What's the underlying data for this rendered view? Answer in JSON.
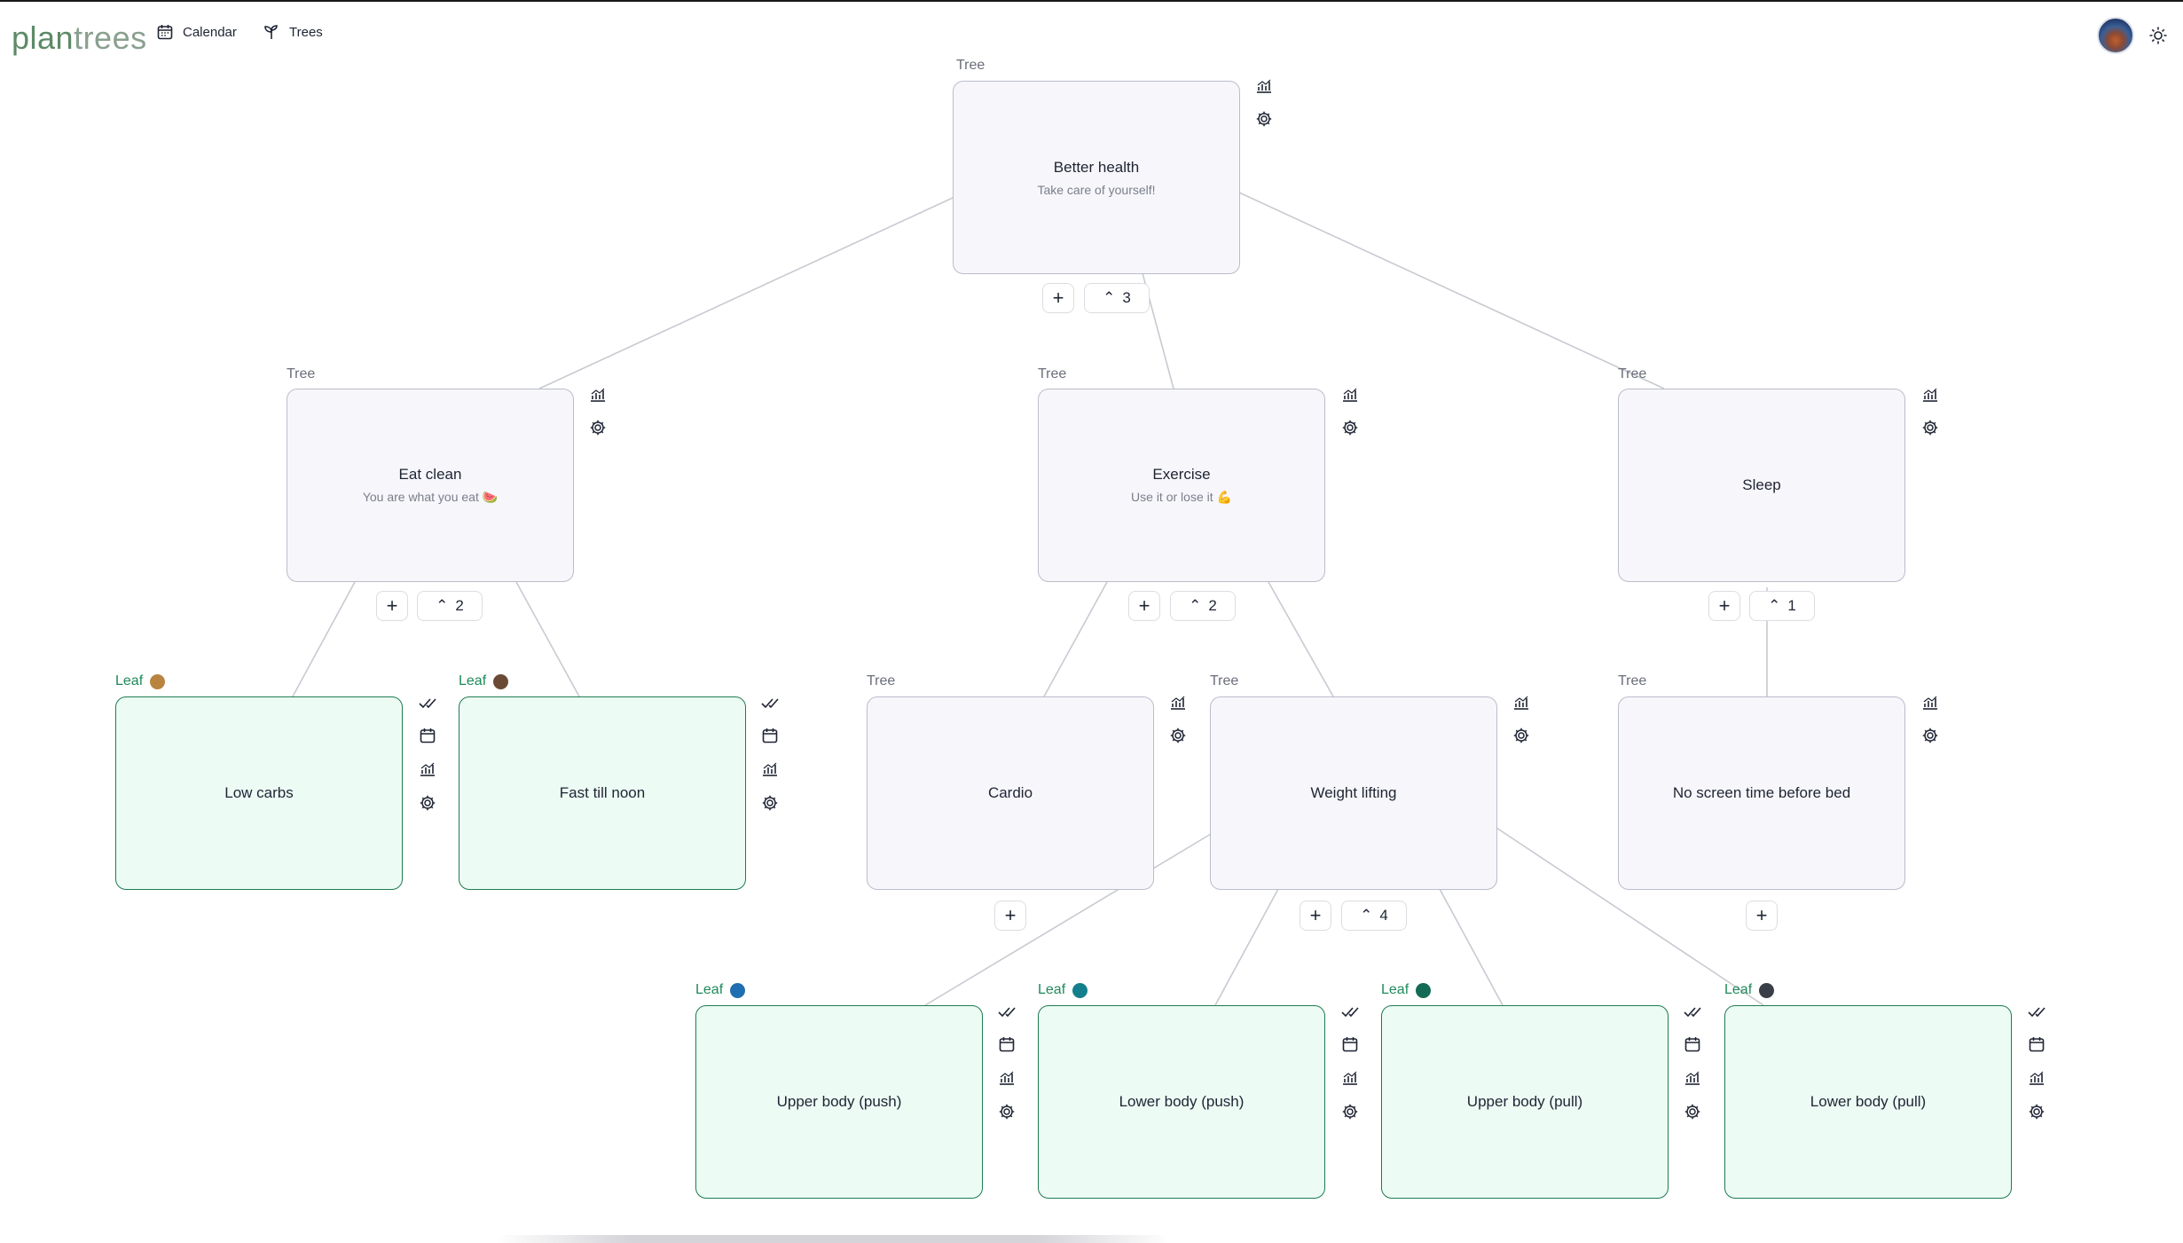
{
  "app": {
    "brand_part1": "plan",
    "brand_part2": "trees",
    "nav": [
      {
        "label": "Calendar",
        "icon": "calendar-icon"
      },
      {
        "label": "Trees",
        "icon": "sprout-icon"
      }
    ],
    "theme_toggle_icon": "sun-icon"
  },
  "colors": {
    "tree_fill": "#f7f7fb",
    "tree_border": "#b9bccb",
    "leaf_fill": "#ecfbf4",
    "leaf_border": "#1e7b52",
    "leaf_label": "#1e8a5a"
  },
  "labels": {
    "tree": "Tree",
    "leaf": "Leaf",
    "add": "+"
  },
  "nodes": [
    {
      "id": "better-health",
      "kind": "Tree",
      "title": "Better health",
      "subtitle": "Take care of yourself!",
      "children_count": "3"
    },
    {
      "id": "eat-clean",
      "kind": "Tree",
      "title": "Eat clean",
      "subtitle": "You are what you eat 🍉",
      "children_count": "2"
    },
    {
      "id": "exercise",
      "kind": "Tree",
      "title": "Exercise",
      "subtitle": "Use it or lose it 💪",
      "children_count": "2"
    },
    {
      "id": "sleep",
      "kind": "Tree",
      "title": "Sleep",
      "subtitle": "",
      "children_count": "1"
    },
    {
      "id": "low-carbs",
      "kind": "Leaf",
      "title": "Low carbs",
      "dot_color": "#b8843f"
    },
    {
      "id": "fast-till-noon",
      "kind": "Leaf",
      "title": "Fast till noon",
      "dot_color": "#6b4a35"
    },
    {
      "id": "cardio",
      "kind": "Tree",
      "title": "Cardio",
      "subtitle": ""
    },
    {
      "id": "weight-lifting",
      "kind": "Tree",
      "title": "Weight lifting",
      "subtitle": "",
      "children_count": "4"
    },
    {
      "id": "no-screen-time",
      "kind": "Tree",
      "title": "No screen time before bed",
      "subtitle": ""
    },
    {
      "id": "upper-push",
      "kind": "Leaf",
      "title": "Upper body (push)",
      "dot_color": "#1f6fb0"
    },
    {
      "id": "lower-push",
      "kind": "Leaf",
      "title": "Lower body (push)",
      "dot_color": "#137f8c"
    },
    {
      "id": "upper-pull",
      "kind": "Leaf",
      "title": "Upper body (pull)",
      "dot_color": "#136b55"
    },
    {
      "id": "lower-pull",
      "kind": "Leaf",
      "title": "Lower body (pull)",
      "dot_color": "#3a3f47"
    }
  ]
}
